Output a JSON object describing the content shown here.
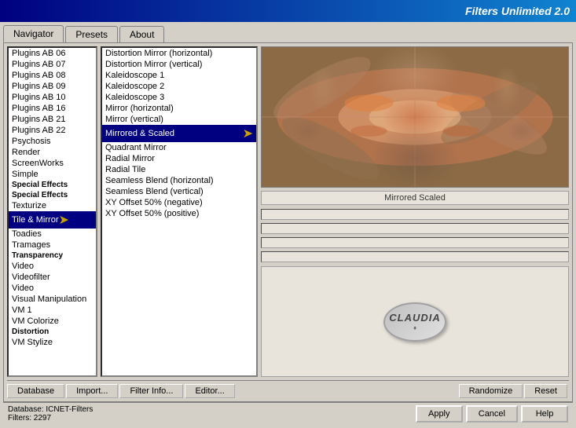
{
  "title": "Filters Unlimited 2.0",
  "tabs": [
    {
      "label": "Navigator",
      "active": true
    },
    {
      "label": "Presets",
      "active": false
    },
    {
      "label": "About",
      "active": false
    }
  ],
  "categories": [
    "Plugins AB 06",
    "Plugins AB 07",
    "Plugins AB 08",
    "Plugins AB 09",
    "Plugins AB 10",
    "Plugins AB 16",
    "Plugins AB 21",
    "Plugins AB 22",
    "Psychosis",
    "Render",
    "ScreenWorks",
    "Simple",
    "Special Effects 1",
    "Special Effects 2",
    "Texturize",
    "Tile & Mirror",
    "Toadies",
    "Tramages",
    "Transparency",
    "Video",
    "Videofilter",
    "Video",
    "Visual Manipulation",
    "VM 1",
    "VM Colorize",
    "VM Distortion",
    "VM Stylize"
  ],
  "selected_category": "Tile & Mirror",
  "filters": [
    "Distortion Mirror (horizontal)",
    "Distortion Mirror (vertical)",
    "Kaleidoscope 1",
    "Kaleidoscope 2",
    "Kaleidoscope 3",
    "Mirror (horizontal)",
    "Mirror (vertical)",
    "Mirrored & Scaled",
    "Quadrant Mirror",
    "Radial Mirror",
    "Radial Tile",
    "Seamless Blend (horizontal)",
    "Seamless Blend (vertical)",
    "XY Offset 50% (negative)",
    "XY Offset 50% (positive)"
  ],
  "selected_filter": "Mirrored & Scaled",
  "filter_name_display": "Mirrored  Scaled",
  "section_labels": {
    "special_effects_1": "Special Effects",
    "special_effects_2": "Special Effects",
    "transparency": "Transparency",
    "distortion": "Distortion"
  },
  "sliders": [
    {
      "label": "",
      "value": ""
    },
    {
      "label": "",
      "value": ""
    },
    {
      "label": "",
      "value": ""
    },
    {
      "label": "",
      "value": ""
    },
    {
      "label": "",
      "value": ""
    }
  ],
  "toolbar_buttons": [
    {
      "label": "Database"
    },
    {
      "label": "Import..."
    },
    {
      "label": "Filter Info..."
    },
    {
      "label": "Editor..."
    },
    {
      "label": "Randomize"
    },
    {
      "label": "Reset"
    }
  ],
  "status": {
    "database_label": "Database:",
    "database_value": "ICNET-Filters",
    "filters_label": "Filters:",
    "filters_value": "2297"
  },
  "action_buttons": {
    "apply": "Apply",
    "cancel": "Cancel",
    "help": "Help"
  },
  "watermark": "CLAUDIA"
}
